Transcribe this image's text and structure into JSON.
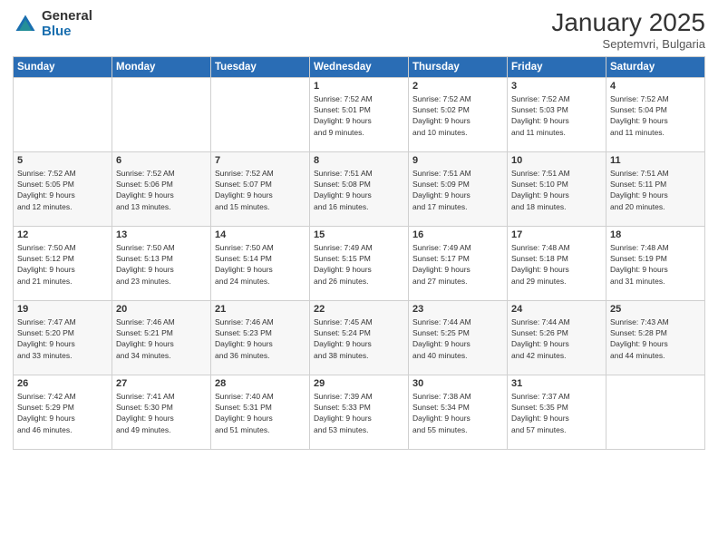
{
  "logo": {
    "general": "General",
    "blue": "Blue"
  },
  "header": {
    "month": "January 2025",
    "location": "Septemvri, Bulgaria"
  },
  "weekdays": [
    "Sunday",
    "Monday",
    "Tuesday",
    "Wednesday",
    "Thursday",
    "Friday",
    "Saturday"
  ],
  "weeks": [
    [
      {
        "day": "",
        "text": ""
      },
      {
        "day": "",
        "text": ""
      },
      {
        "day": "",
        "text": ""
      },
      {
        "day": "1",
        "text": "Sunrise: 7:52 AM\nSunset: 5:01 PM\nDaylight: 9 hours\nand 9 minutes."
      },
      {
        "day": "2",
        "text": "Sunrise: 7:52 AM\nSunset: 5:02 PM\nDaylight: 9 hours\nand 10 minutes."
      },
      {
        "day": "3",
        "text": "Sunrise: 7:52 AM\nSunset: 5:03 PM\nDaylight: 9 hours\nand 11 minutes."
      },
      {
        "day": "4",
        "text": "Sunrise: 7:52 AM\nSunset: 5:04 PM\nDaylight: 9 hours\nand 11 minutes."
      }
    ],
    [
      {
        "day": "5",
        "text": "Sunrise: 7:52 AM\nSunset: 5:05 PM\nDaylight: 9 hours\nand 12 minutes."
      },
      {
        "day": "6",
        "text": "Sunrise: 7:52 AM\nSunset: 5:06 PM\nDaylight: 9 hours\nand 13 minutes."
      },
      {
        "day": "7",
        "text": "Sunrise: 7:52 AM\nSunset: 5:07 PM\nDaylight: 9 hours\nand 15 minutes."
      },
      {
        "day": "8",
        "text": "Sunrise: 7:51 AM\nSunset: 5:08 PM\nDaylight: 9 hours\nand 16 minutes."
      },
      {
        "day": "9",
        "text": "Sunrise: 7:51 AM\nSunset: 5:09 PM\nDaylight: 9 hours\nand 17 minutes."
      },
      {
        "day": "10",
        "text": "Sunrise: 7:51 AM\nSunset: 5:10 PM\nDaylight: 9 hours\nand 18 minutes."
      },
      {
        "day": "11",
        "text": "Sunrise: 7:51 AM\nSunset: 5:11 PM\nDaylight: 9 hours\nand 20 minutes."
      }
    ],
    [
      {
        "day": "12",
        "text": "Sunrise: 7:50 AM\nSunset: 5:12 PM\nDaylight: 9 hours\nand 21 minutes."
      },
      {
        "day": "13",
        "text": "Sunrise: 7:50 AM\nSunset: 5:13 PM\nDaylight: 9 hours\nand 23 minutes."
      },
      {
        "day": "14",
        "text": "Sunrise: 7:50 AM\nSunset: 5:14 PM\nDaylight: 9 hours\nand 24 minutes."
      },
      {
        "day": "15",
        "text": "Sunrise: 7:49 AM\nSunset: 5:15 PM\nDaylight: 9 hours\nand 26 minutes."
      },
      {
        "day": "16",
        "text": "Sunrise: 7:49 AM\nSunset: 5:17 PM\nDaylight: 9 hours\nand 27 minutes."
      },
      {
        "day": "17",
        "text": "Sunrise: 7:48 AM\nSunset: 5:18 PM\nDaylight: 9 hours\nand 29 minutes."
      },
      {
        "day": "18",
        "text": "Sunrise: 7:48 AM\nSunset: 5:19 PM\nDaylight: 9 hours\nand 31 minutes."
      }
    ],
    [
      {
        "day": "19",
        "text": "Sunrise: 7:47 AM\nSunset: 5:20 PM\nDaylight: 9 hours\nand 33 minutes."
      },
      {
        "day": "20",
        "text": "Sunrise: 7:46 AM\nSunset: 5:21 PM\nDaylight: 9 hours\nand 34 minutes."
      },
      {
        "day": "21",
        "text": "Sunrise: 7:46 AM\nSunset: 5:23 PM\nDaylight: 9 hours\nand 36 minutes."
      },
      {
        "day": "22",
        "text": "Sunrise: 7:45 AM\nSunset: 5:24 PM\nDaylight: 9 hours\nand 38 minutes."
      },
      {
        "day": "23",
        "text": "Sunrise: 7:44 AM\nSunset: 5:25 PM\nDaylight: 9 hours\nand 40 minutes."
      },
      {
        "day": "24",
        "text": "Sunrise: 7:44 AM\nSunset: 5:26 PM\nDaylight: 9 hours\nand 42 minutes."
      },
      {
        "day": "25",
        "text": "Sunrise: 7:43 AM\nSunset: 5:28 PM\nDaylight: 9 hours\nand 44 minutes."
      }
    ],
    [
      {
        "day": "26",
        "text": "Sunrise: 7:42 AM\nSunset: 5:29 PM\nDaylight: 9 hours\nand 46 minutes."
      },
      {
        "day": "27",
        "text": "Sunrise: 7:41 AM\nSunset: 5:30 PM\nDaylight: 9 hours\nand 49 minutes."
      },
      {
        "day": "28",
        "text": "Sunrise: 7:40 AM\nSunset: 5:31 PM\nDaylight: 9 hours\nand 51 minutes."
      },
      {
        "day": "29",
        "text": "Sunrise: 7:39 AM\nSunset: 5:33 PM\nDaylight: 9 hours\nand 53 minutes."
      },
      {
        "day": "30",
        "text": "Sunrise: 7:38 AM\nSunset: 5:34 PM\nDaylight: 9 hours\nand 55 minutes."
      },
      {
        "day": "31",
        "text": "Sunrise: 7:37 AM\nSunset: 5:35 PM\nDaylight: 9 hours\nand 57 minutes."
      },
      {
        "day": "",
        "text": ""
      }
    ]
  ]
}
